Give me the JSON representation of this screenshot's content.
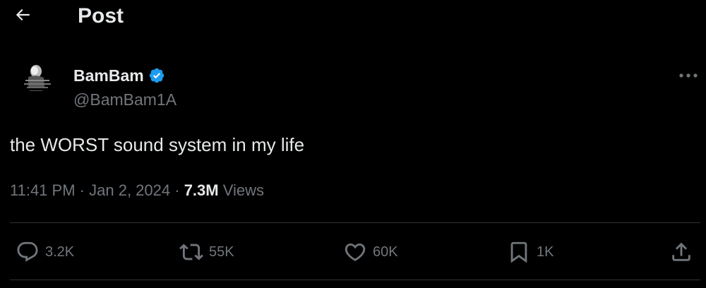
{
  "header": {
    "title": "Post",
    "back_icon": "arrow-left-icon"
  },
  "author": {
    "display_name": "BamBam",
    "handle": "@BamBam1A",
    "verified": true,
    "verified_icon": "verified-badge-icon",
    "verified_color": "#1d9bf0"
  },
  "tweet": {
    "text": "the WORST sound system in my life",
    "time": "11:41 PM",
    "date": "Jan 2, 2024",
    "views_count": "7.3M",
    "views_label": "Views"
  },
  "actions": {
    "reply": {
      "icon": "reply-icon",
      "count": "3.2K"
    },
    "repost": {
      "icon": "repost-icon",
      "count": "55K"
    },
    "like": {
      "icon": "heart-icon",
      "count": "60K"
    },
    "bookmark": {
      "icon": "bookmark-icon",
      "count": "1K"
    },
    "share": {
      "icon": "share-icon"
    }
  },
  "colors": {
    "background": "#000000",
    "text_primary": "#e7e9ea",
    "text_secondary": "#71767b",
    "divider": "#2f3336"
  }
}
